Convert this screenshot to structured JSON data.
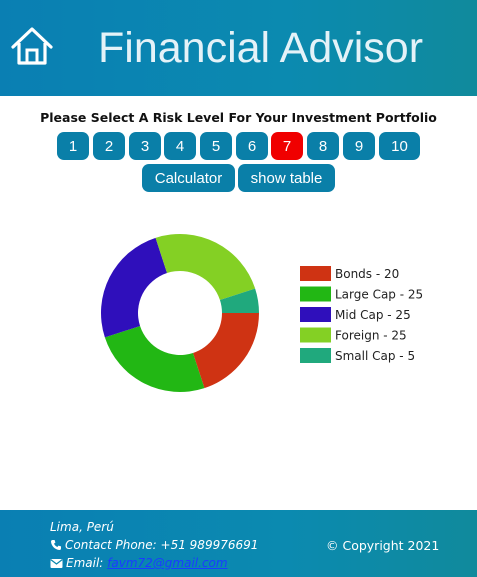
{
  "header": {
    "title": "Financial Advisor"
  },
  "risk": {
    "prompt": "Please Select A Risk Level For Your Investment Portfolio",
    "levels": [
      "1",
      "2",
      "3",
      "4",
      "5",
      "6",
      "7",
      "8",
      "9",
      "10"
    ],
    "selected": "7"
  },
  "actions": {
    "calculator_label": "Calculator",
    "table_label": "show table"
  },
  "chart_data": {
    "type": "pie",
    "categories": [
      "Bonds",
      "Large Cap",
      "Mid Cap",
      "Foreign",
      "Small Cap"
    ],
    "values": [
      20,
      25,
      25,
      25,
      5
    ],
    "legend": [
      "Bonds - 20",
      "Large Cap - 25",
      "Mid Cap - 25",
      "Foreign - 25",
      "Small Cap - 5"
    ],
    "colors": [
      "#cf3313",
      "#22b714",
      "#2f0fbb",
      "#84d024",
      "#20a97d"
    ],
    "legend_position": "right"
  },
  "footer": {
    "location": "Lima, Perú",
    "phone": "Contact Phone: +51 989976691",
    "email_label": "Email: ",
    "email": "favm72@gmail.com",
    "copyright": "© Copyright 2021"
  }
}
